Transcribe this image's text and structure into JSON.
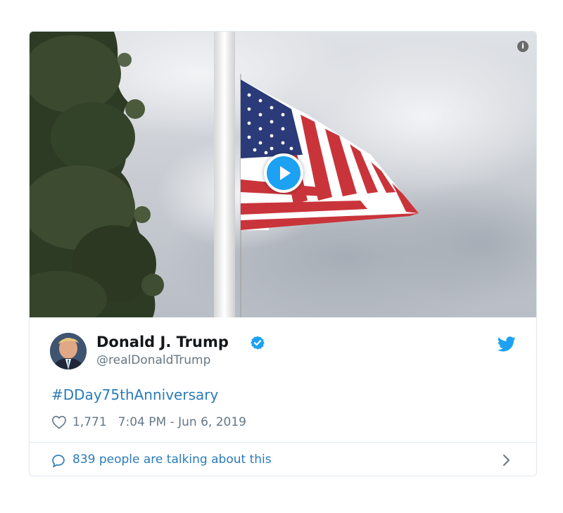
{
  "media": {
    "kind": "video",
    "thumbnail": "american-flag-half-staff",
    "play_icon": "play-icon",
    "info_icon": "info-icon",
    "info_glyph": "i"
  },
  "author": {
    "name": "Donald J. Trump",
    "handle": "@realDonaldTrump",
    "verified": true,
    "avatar": "avatar"
  },
  "tweet": {
    "text": "#DDay75thAnniversary",
    "like_count": "1,771",
    "timestamp": "7:04 PM - Jun 6, 2019"
  },
  "footer": {
    "talking_label": "839 people are talking about this"
  },
  "colors": {
    "link": "#2b7bb9",
    "twitter_blue": "#1da1f2",
    "muted": "#657786",
    "border": "#e1e8ed"
  }
}
